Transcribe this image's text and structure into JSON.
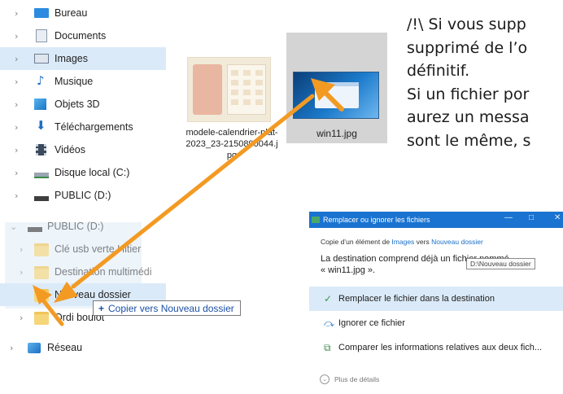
{
  "nav": {
    "items": [
      {
        "label": "Bureau",
        "icon": "desktop-icon"
      },
      {
        "label": "Documents",
        "icon": "documents-icon"
      },
      {
        "label": "Images",
        "icon": "images-icon"
      },
      {
        "label": "Musique",
        "icon": "music-icon"
      },
      {
        "label": "Objets 3D",
        "icon": "3d-objects-icon"
      },
      {
        "label": "Téléchargements",
        "icon": "downloads-icon"
      },
      {
        "label": "Vidéos",
        "icon": "videos-icon"
      },
      {
        "label": "Disque local (C:)",
        "icon": "local-disk-icon"
      },
      {
        "label": "PUBLIC (D:)",
        "icon": "usb-drive-icon"
      }
    ],
    "public_expanded": {
      "label": "PUBLIC (D:)",
      "icon": "usb-drive-icon"
    },
    "children": [
      {
        "label": "Clé usb verte Hitier"
      },
      {
        "label": "Destination multimédi"
      },
      {
        "label": "Nouveau dossier"
      },
      {
        "label": "Ordi boulot"
      }
    ],
    "network": {
      "label": "Réseau",
      "icon": "network-icon"
    }
  },
  "files": {
    "calendar": {
      "name": "modele-calendrier-plat-2023_23-2150890044.jpg",
      "name_display": "modele-calendrier-plat-2023_23-2150890044.jpg"
    },
    "win11": {
      "name": "win11.jpg"
    }
  },
  "big_text": {
    "line1": "/!\\ Si vous supp",
    "line2": "supprimé de l’o",
    "line3": "définitif.",
    "line4": "Si un fichier por",
    "line5": "aurez un messa",
    "line6": "sont le même, s"
  },
  "drag_tooltip": {
    "plus": "+",
    "text": "Copier vers Nouveau dossier"
  },
  "dialog": {
    "title": "Remplacer ou ignorer les fichiers",
    "copy_prefix": "Copie d’un élément de ",
    "copy_from": "Images",
    "copy_mid": " vers ",
    "copy_to": "Nouveau dossier",
    "dest_line1": "La destination comprend déjà un fichier nommé",
    "dest_line2": "« win11.jpg ».",
    "tooltip": "D:\\Nouveau dossier",
    "options": [
      {
        "icon": "checkmark-icon",
        "glyph": "✓",
        "label": "Remplacer le fichier dans la destination"
      },
      {
        "icon": "skip-icon",
        "glyph": "⤼",
        "label": "Ignorer ce fichier"
      },
      {
        "icon": "compare-icon",
        "glyph": "⧉",
        "label": "Comparer les informations relatives aux deux fich..."
      }
    ],
    "more": "Plus de détails",
    "controls": {
      "minimize": "—",
      "maximize": "□",
      "close": "✕"
    }
  },
  "colors": {
    "accent": "#1a73d0",
    "arrow": "#f39a23",
    "selection": "#dbeaf8",
    "folder": "#f6d67a"
  }
}
